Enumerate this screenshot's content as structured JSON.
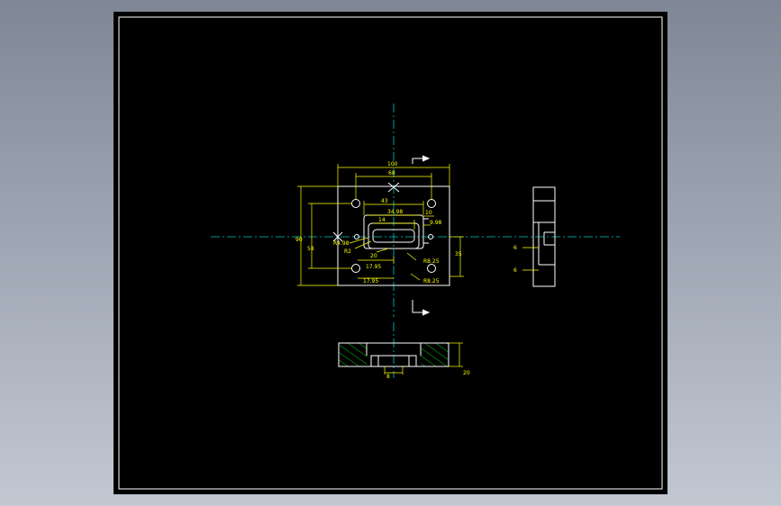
{
  "colors": {
    "background": "#000000",
    "outer_frame": "#8a909c",
    "border": "#ffffff",
    "geometry": "#ffffff",
    "dimension": "#ffff00",
    "centerline": "#00c8c8",
    "hatch": "#00ff00"
  },
  "dimensions": {
    "overall_width": "100",
    "hole_spacing": "68",
    "slot_width": "43",
    "inner_width": "34.98",
    "inner_slot": "14",
    "right_small": "10",
    "right_small2": "9.98",
    "overall_height": "90",
    "hole_vert": "58",
    "offset_right": "35",
    "radius_left": "R4.98",
    "radius_r2": "R2",
    "center_20": "20",
    "r825_upper": "R8.25",
    "r825_lower": "R8.25",
    "offset_1795_upper": "17.95",
    "offset_1795_lower": "17.95",
    "depth_8": "8",
    "thickness_20": "20",
    "side_6_upper": "6",
    "side_6_lower": "6"
  }
}
